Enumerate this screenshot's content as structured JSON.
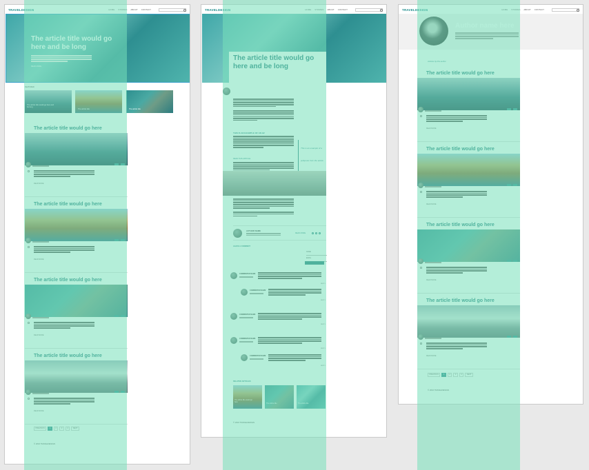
{
  "brand": {
    "logo": "TRAVELDESIGN"
  },
  "nav": {
    "items": [
      "HOME",
      "STORIES",
      "ABOUT",
      "CONTACT"
    ],
    "search_placeholder": "Search"
  },
  "left": {
    "hero_title": "The article title would go here and be long",
    "hero_read_more": "READ MORE",
    "featured_label": "FEATURED",
    "featured": [
      {
        "title": "The article title would go here and be long"
      },
      {
        "title": "The article title"
      },
      {
        "title": "The article title"
      }
    ],
    "articles": [
      {
        "title": "The article title would go here",
        "image": "lake"
      },
      {
        "title": "The article title would go here",
        "image": "rock"
      },
      {
        "title": "The article title would go here",
        "image": "reef"
      },
      {
        "title": "The article title would go here",
        "image": "smoke"
      }
    ],
    "read_more": "READ MORE",
    "pagination": [
      "PREVIOUS",
      "1",
      "2",
      "3",
      "4",
      "NEXT"
    ],
    "footer": "© 2016 TRAVELDESIGN"
  },
  "middle": {
    "hero_title": "The article title would go here and be long",
    "subheading": "THIS IS AN EXAMPLE OF AN H2",
    "pullquote": "This is an example of a pullquote from the article that stands out from the article",
    "link_text": "READ THIS ARTICLE",
    "author_name": "AUTHOR NAME",
    "author_more": "READ MORE",
    "comments_label": "LEAVE A COMMENT",
    "form_name": "NAME",
    "form_email": "EMAIL",
    "submit": "SUBMIT",
    "commenter": "COMMENTER NAME",
    "reply": "REPLY",
    "related_label": "RELATED ARTICLES",
    "related": [
      {
        "title": "The article title would go here"
      },
      {
        "title": "The article title"
      },
      {
        "title": "The article title"
      }
    ],
    "footer": "© 2016 TRAVELDESIGN"
  },
  "right": {
    "author_name": "Author name here",
    "section_label": "Articles by this author",
    "articles": [
      {
        "title": "The article title would go here",
        "image": "lake"
      },
      {
        "title": "The article title would go here",
        "image": "rock"
      },
      {
        "title": "The article title would go here",
        "image": "reef"
      },
      {
        "title": "The article title would go here",
        "image": "smoke"
      }
    ],
    "read_more": "READ MORE",
    "pagination": [
      "PREVIOUS",
      "1",
      "2",
      "3",
      "4",
      "NEXT"
    ],
    "footer": "© 2016 TRAVELDESIGN"
  },
  "colors": {
    "accent": "#1f7a7a",
    "overlay": "#76e0ba",
    "page_bg": "#e9e9e9"
  }
}
